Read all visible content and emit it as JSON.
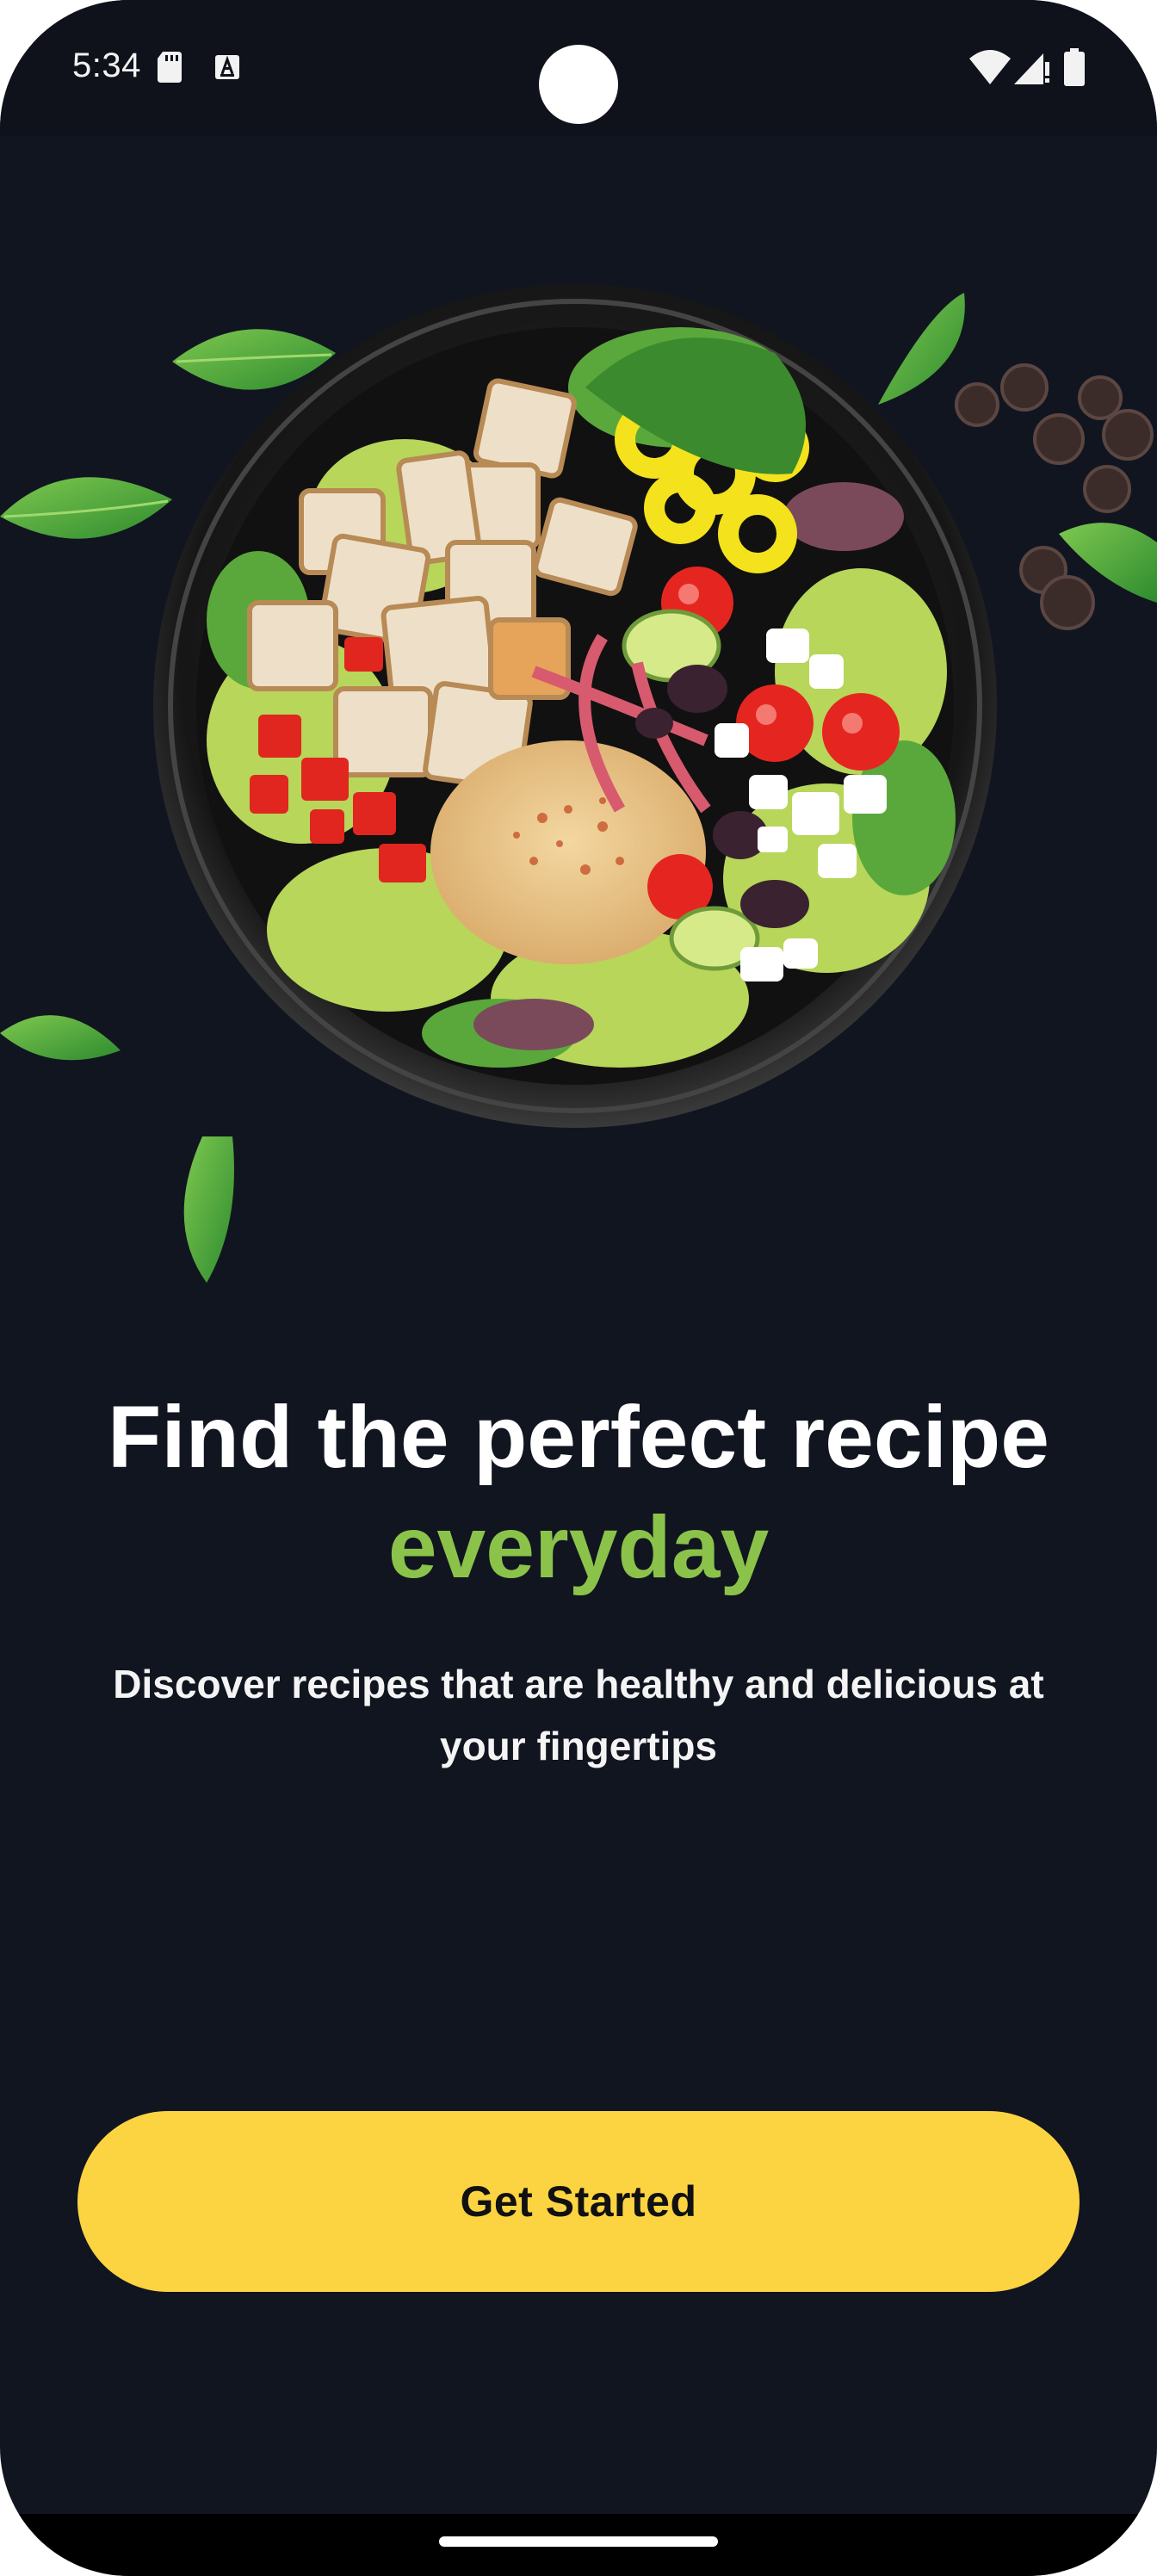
{
  "status_bar": {
    "time": "5:34",
    "left_icons": [
      "sd-card-icon",
      "text-a-icon"
    ],
    "right_icons": [
      "wifi-icon",
      "cell-signal-icon",
      "battery-icon"
    ]
  },
  "hero": {
    "image": "salad-bowl-illustration",
    "decorations": [
      "basil-leaf-icon",
      "peppercorns-icon"
    ]
  },
  "onboarding": {
    "title_line": "Find the perfect recipe",
    "title_accent": "everyday",
    "subtitle": "Discover recipes that are healthy and delicious at your fingertips",
    "cta_label": "Get Started"
  },
  "colors": {
    "background": "#111520",
    "accent_green": "#8bc34a",
    "cta_yellow": "#fcd441"
  }
}
